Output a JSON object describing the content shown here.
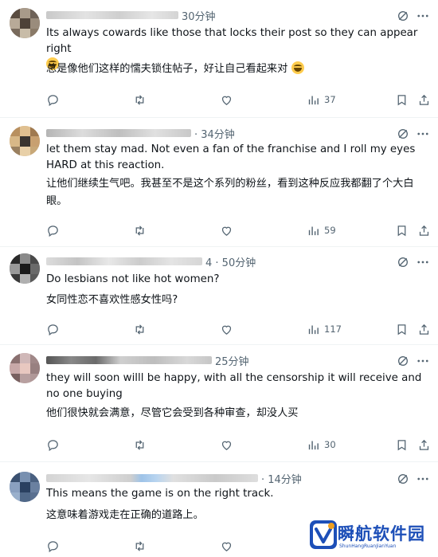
{
  "replies": [
    {
      "time": "30分钟",
      "text": "Its always cowards like those that locks their post so they can appear right",
      "text_cn": "总是像他们这样的懦夫锁住帖子，好让自己看起来对",
      "views": "37"
    },
    {
      "time": "· 34分钟",
      "text": "let them stay mad. Not even a fan of the franchise and I roll my eyes HARD at this reaction.",
      "text_cn": "让他们继续生气吧。我甚至不是这个系列的粉丝，看到这种反应我都翻了个大白眼。",
      "views": "59"
    },
    {
      "time": "4 · 50分钟",
      "text": "Do lesbians not like hot women?",
      "text_cn": "女同性恋不喜欢性感女性吗?",
      "views": "117"
    },
    {
      "time": "25分钟",
      "text": "they will soon willl be happy, with all the censorship it will receive and no one buying",
      "text_cn": "他们很快就会满意，尽管它会受到各种审查，却没人买",
      "views": "30"
    },
    {
      "time": "· 14分钟",
      "text": "This means the game is on the right track.",
      "text_cn": "这意味着游戏走在正确的道路上。",
      "views": ""
    }
  ],
  "icons": {
    "reply": "reply-icon",
    "repost": "repost-icon",
    "like": "like-icon",
    "views": "views-icon",
    "bookmark": "bookmark-icon",
    "share": "share-icon",
    "mute": "mute-icon",
    "more": "more-icon"
  },
  "watermark": {
    "title": "瞬航软件园",
    "subtitle": "ShunHangRuanJianYuan"
  },
  "colors": {
    "text": "#0f1419",
    "secondary": "#536471",
    "divider": "#eff3f4",
    "watermark": "#1d4fb8"
  }
}
